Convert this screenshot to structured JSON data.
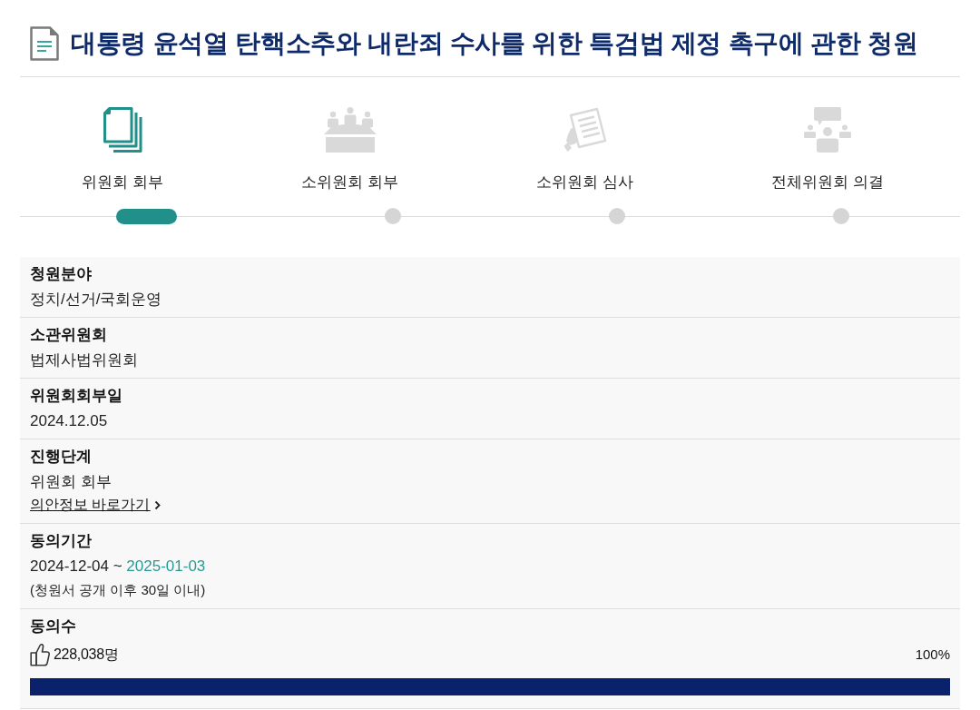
{
  "title": "대통령 윤석열 탄핵소추와 내란죄 수사를 위한 특검법 제정 촉구에 관한 청원",
  "steps": [
    {
      "kind": "documents",
      "label": "위원회 회부",
      "selected": true
    },
    {
      "kind": "meeting",
      "label": "소위원회 회부",
      "selected": false
    },
    {
      "kind": "review",
      "label": "소위원회 심사",
      "selected": false
    },
    {
      "kind": "discussion",
      "label": "전체위원회 의결",
      "selected": false
    }
  ],
  "details": [
    {
      "kind": "text",
      "label": "청원분야",
      "value": "정치/선거/국회운영"
    },
    {
      "kind": "text",
      "label": "소관위원회",
      "value": "법제사법위원회"
    },
    {
      "kind": "text",
      "label": "위원회회부일",
      "value": "2024.12.05"
    },
    {
      "kind": "link",
      "label": "진행단계",
      "value": "위원회 회부",
      "link": "의안정보 바로가기"
    },
    {
      "kind": "period",
      "label": "동의기간",
      "start": "2024-12-04 ~",
      "end": "2025-01-03",
      "note": "(청원서 공개 이후 30일 이내)"
    },
    {
      "kind": "count",
      "label": "동의수",
      "count": "228,038명",
      "percent": "100%",
      "level": 1
    }
  ]
}
